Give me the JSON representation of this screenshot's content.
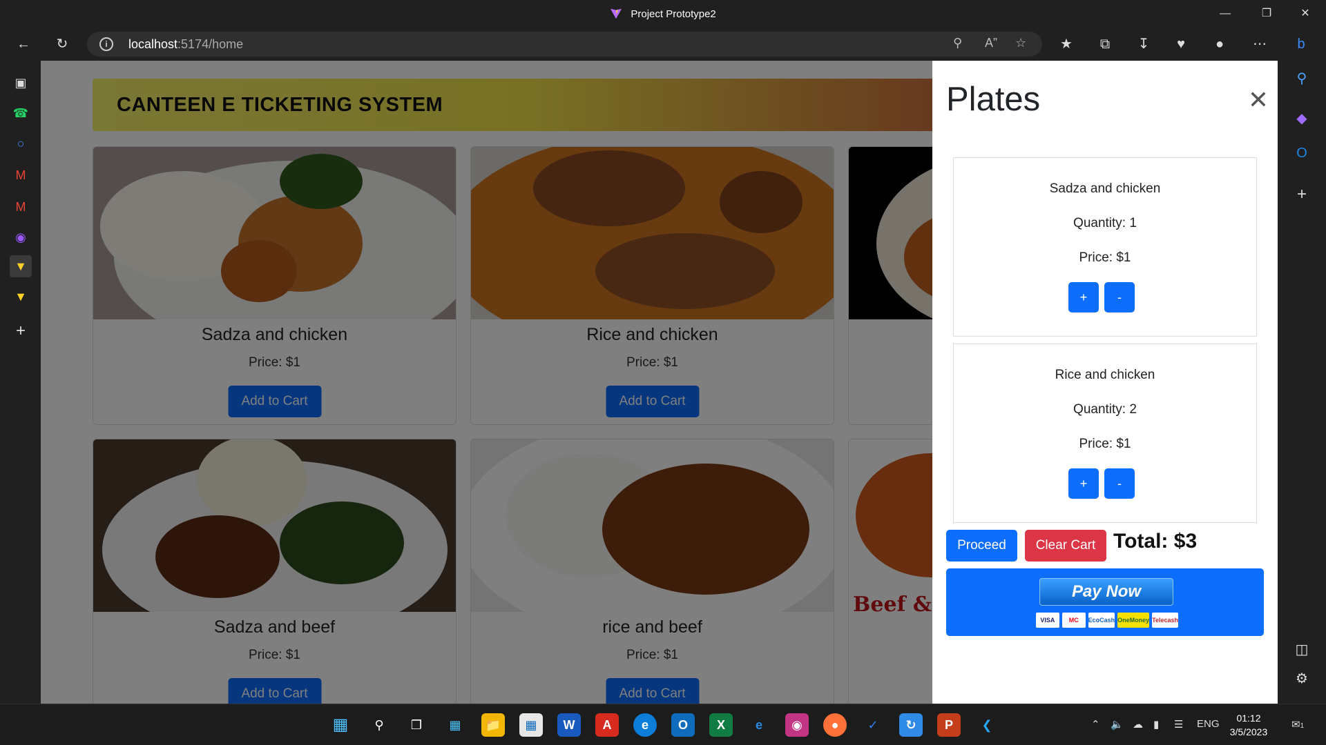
{
  "window": {
    "title": "Project Prototype2"
  },
  "address": {
    "host": "localhost",
    "path": ":5174/home"
  },
  "page": {
    "banner": "CANTEEN E TICKETING SYSTEM",
    "add_label": "Add to Cart",
    "cards": [
      {
        "name": "Sadza and chicken",
        "price": "Price: $1"
      },
      {
        "name": "Rice and chicken",
        "price": "Price: $1"
      },
      {
        "name": "Sadza and beef",
        "price": "Price: $1"
      },
      {
        "name": "rice and beef",
        "price": "Price: $1"
      }
    ],
    "partial_card_text": "Beef &"
  },
  "drawer": {
    "title": "Plates",
    "close_icon": "close-icon",
    "plates": [
      {
        "name": "Sadza and chicken",
        "quantity": "Quantity: 1",
        "price": "Price: $1"
      },
      {
        "name": "Rice and chicken",
        "quantity": "Quantity: 2",
        "price": "Price: $1"
      }
    ],
    "plus_label": "+",
    "minus_label": "-",
    "proceed_label": "Proceed",
    "clear_label": "Clear Cart",
    "total": "Total: $3",
    "pay_now_label": "Pay Now",
    "pay_cards": [
      "VISA",
      "MC",
      "EcoCash",
      "OneMoney",
      "Telecash"
    ]
  },
  "taskbar": {
    "language": "ENG",
    "time": "01:12",
    "date": "3/5/2023",
    "notification_count": "1"
  }
}
